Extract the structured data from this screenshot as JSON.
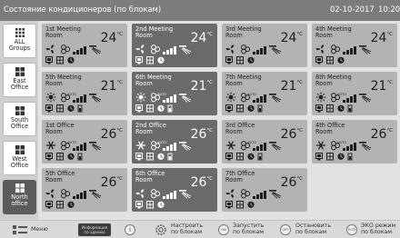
{
  "header": {
    "title": "Состояние кондиционеров (по блокам)",
    "date": "02-10-2017",
    "time": "10:20"
  },
  "sidebar": {
    "items": [
      {
        "label": "ALL\nGroups",
        "active": false
      },
      {
        "label": "East\nOffice",
        "active": false
      },
      {
        "label": "South\nOffice",
        "active": false
      },
      {
        "label": "West\nOffice",
        "active": false
      },
      {
        "label": "North\noffice",
        "active": true
      }
    ]
  },
  "units": [
    {
      "name": "1st Meeting\nRoom",
      "temp": "24",
      "unit": "°C",
      "mode": "fan",
      "selected": false
    },
    {
      "name": "2nd Meeting\nRoom",
      "temp": "24",
      "unit": "°C",
      "mode": "fan",
      "selected": true
    },
    {
      "name": "3rd Meeting\nRoom",
      "temp": "24",
      "unit": "°C",
      "mode": "fan",
      "selected": false
    },
    {
      "name": "4th Meeting\nRoom",
      "temp": "24",
      "unit": "°C",
      "mode": "fan",
      "selected": false
    },
    {
      "name": "5th Meeting\nRoom",
      "temp": "21",
      "unit": "°C",
      "mode": "heat",
      "selected": false
    },
    {
      "name": "6th Meeting\nRoom",
      "temp": "21",
      "unit": "°C",
      "mode": "heat",
      "selected": true
    },
    {
      "name": "7th Meeting\nRoom",
      "temp": "21",
      "unit": "°C",
      "mode": "heat",
      "selected": false
    },
    {
      "name": "8th Meeting\nRoom",
      "temp": "21",
      "unit": "°C",
      "mode": "heat",
      "selected": false
    },
    {
      "name": "1st Office\nRoom",
      "temp": "26",
      "unit": "°C",
      "mode": "cool",
      "selected": false
    },
    {
      "name": "2nd Office\nRoom",
      "temp": "26",
      "unit": "°C",
      "mode": "cool",
      "selected": true
    },
    {
      "name": "3rd Office\nRoom",
      "temp": "26",
      "unit": "°C",
      "mode": "cool",
      "selected": false
    },
    {
      "name": "4th Office\nRoom",
      "temp": "26",
      "unit": "°C",
      "mode": "cool",
      "selected": false
    },
    {
      "name": "5th Office\nRoom",
      "temp": "26",
      "unit": "°C",
      "mode": "fan",
      "selected": false
    },
    {
      "name": "6th Office\nRoom",
      "temp": "26",
      "unit": "°C",
      "mode": "fan",
      "selected": true
    },
    {
      "name": "7th Office\nRoom",
      "temp": "26",
      "unit": "°C",
      "mode": "fan",
      "selected": false
    }
  ],
  "fan_auto_label": "AUTO",
  "footer": {
    "menu": "Меню",
    "info": "Информация\nпо зданию",
    "setup": "Настроить\nпо блокам",
    "start": "Запустить\nпо блокам",
    "stop": "Остановить\nпо блокам",
    "eco": "ЭКО режим\nпо блокам",
    "on_badge": "ON",
    "off_badge": "OFF",
    "eco_badge": "ECO"
  },
  "colors": {
    "header": "#7c7c7c",
    "tile": "#b3b3b3",
    "tile_selected": "#6a6a6a",
    "sidebar_active": "#5b5b5b"
  }
}
